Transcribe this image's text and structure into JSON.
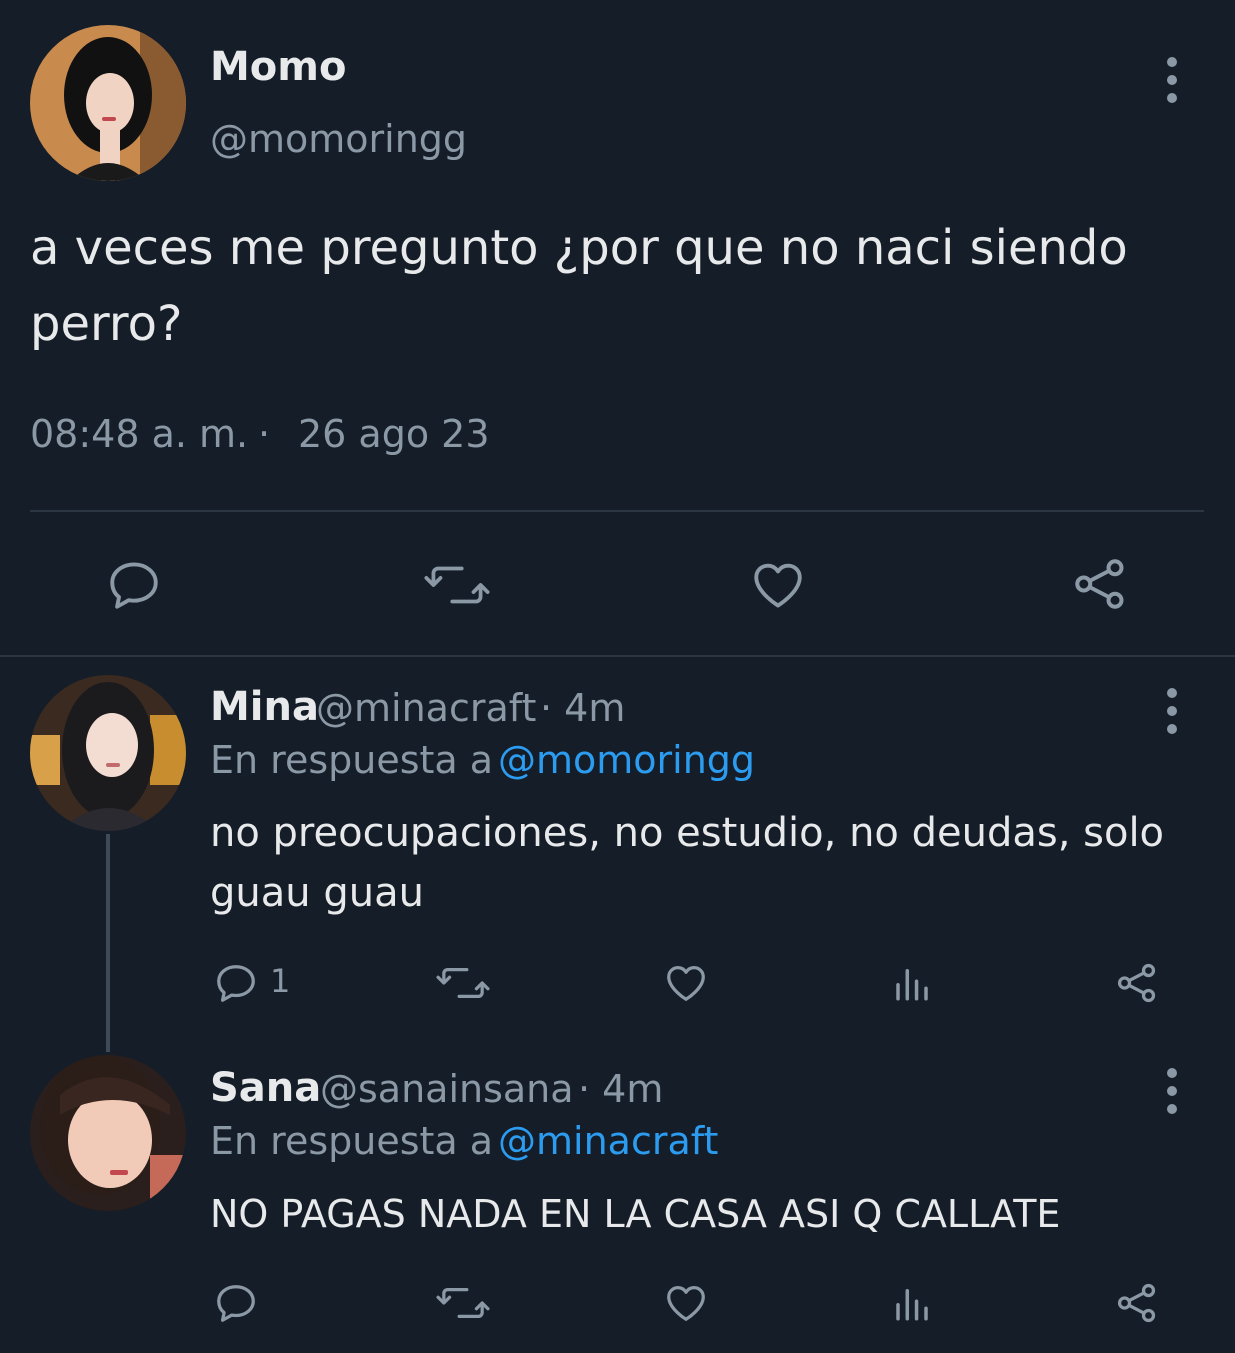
{
  "main_tweet": {
    "name": "Momo",
    "handle": "@momoringg",
    "text_line1": "a veces me pregunto ¿por que no naci siendo",
    "text_line2": "perro?",
    "time": "08:48 a. m.",
    "separator": "·",
    "date": "26 ago 23",
    "actions": [
      "reply-icon",
      "retweet-icon",
      "like-icon",
      "share-icon"
    ]
  },
  "replies": [
    {
      "name": "Mina",
      "handle": "@minacraft",
      "meta": "· 4m",
      "reply_prefix": "En respuesta a",
      "reply_to": "@momoringg",
      "text_line1": "no preocupaciones, no estudio, no deudas, solo",
      "text_line2": "guau guau",
      "reply_count": "1"
    },
    {
      "name": "Sana",
      "handle": "@sanainsana",
      "meta": "· 4m",
      "reply_prefix": "En respuesta a",
      "reply_to": "@minacraft",
      "text_line1": "NO PAGAS NADA EN LA CASA ASI Q CALLATE"
    }
  ],
  "colors": {
    "background": "#151d28",
    "text": "#e7e9ea",
    "muted": "#8b98a5",
    "link": "#2c9cf0",
    "divider": "#2b3642"
  }
}
